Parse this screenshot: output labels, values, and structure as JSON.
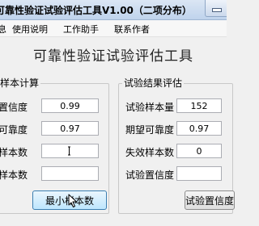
{
  "window": {
    "title": "可靠性验证试验评估工具V1.00（二项分布）"
  },
  "menu": {
    "items": [
      "息",
      "使用说明",
      "工作助手",
      "联系作者"
    ]
  },
  "app": {
    "heading": "可靠性验证试验评估工具"
  },
  "sample_calc": {
    "title": "样本计算",
    "fields": [
      {
        "label": "置信度",
        "value": "0.99"
      },
      {
        "label": "可靠度",
        "value": "0.97"
      },
      {
        "label": "样本数",
        "value": ""
      },
      {
        "label": "样本数",
        "value": ""
      }
    ],
    "button": "最小样本数"
  },
  "result_eval": {
    "title": "试验结果评估",
    "fields": [
      {
        "label": "试验样本量",
        "value": "152"
      },
      {
        "label": "期望可靠度",
        "value": "0.97"
      },
      {
        "label": "失效样本数",
        "value": "0"
      },
      {
        "label": "试验置信度",
        "value": ""
      }
    ],
    "button": "试验置信度"
  }
}
